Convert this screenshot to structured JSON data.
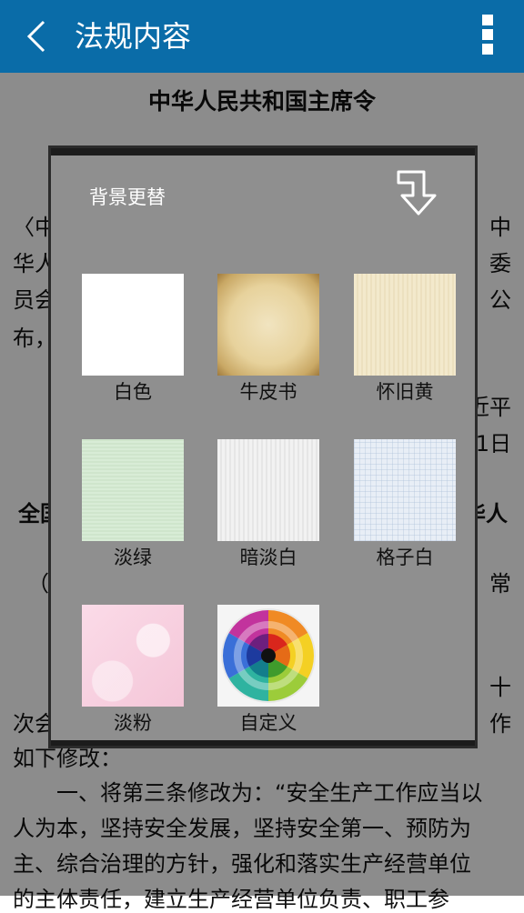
{
  "appbar": {
    "title": "法规内容"
  },
  "document": {
    "heading": "中华人民共和国主席令",
    "fragments": {
      "l1_left": "〈中",
      "l1_right": "中",
      "l2_left": "华人",
      "l2_right": "委",
      "l3_left": "员会",
      "l3_right": "公",
      "l4_left": "布，",
      "l5_right": "近平",
      "l6_right": "1日",
      "l7_left": "全国",
      "l7_right": "华人",
      "l8_left": "（2",
      "l8_right": "常",
      "l9_right": "十",
      "l10_left": "次会",
      "l10_right": "作",
      "l11": "如下修改：",
      "p1": "　　一、将第三条修改为：“安全生产工作应当以",
      "p2": "人为本，坚持安全发展，坚持安全第一、预防为",
      "p3": "主、综合治理的方针，强化和落实生产经营单位",
      "p4": "的主体责任，建立生产经营单位负责、职工参"
    }
  },
  "dialog": {
    "title": "背景更替",
    "options": [
      {
        "label": "白色"
      },
      {
        "label": "牛皮书"
      },
      {
        "label": "怀旧黄"
      },
      {
        "label": "淡绿"
      },
      {
        "label": "暗淡白"
      },
      {
        "label": "格子白"
      },
      {
        "label": "淡粉"
      },
      {
        "label": "自定义"
      }
    ]
  },
  "colors": {
    "appbar": "#0a6ca8",
    "dialog": "#8f8f8f"
  },
  "icons": [
    "back-icon",
    "overflow-menu-icon",
    "collapse-arrow-icon",
    "color-wheel-icon"
  ]
}
